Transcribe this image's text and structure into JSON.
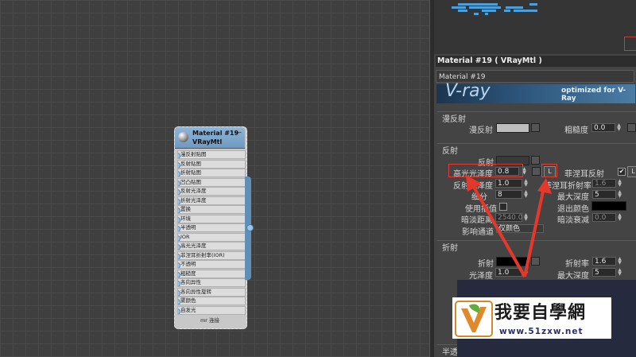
{
  "node": {
    "title_line1": "Material #19",
    "title_line2": "VRayMtl",
    "collapse": "—",
    "slots": [
      "漫反射贴图",
      "反射贴图",
      "折射贴图",
      "凹凸贴图",
      "反射光泽度",
      "折射光泽度",
      "置换",
      "环境",
      "半透明",
      "IOR",
      "高光光泽度",
      "菲涅耳折射率(IOR)",
      "不透明",
      "粗糙度",
      "各向异性",
      "各向异性旋转",
      "雾颜色",
      "自发光"
    ],
    "footer": "mr 连接"
  },
  "material": {
    "title": "Material #19 ( VRayMtl )",
    "name_field": "Material #19"
  },
  "banner": {
    "logo": "V-ray",
    "tagline": "optimized for V-Ray"
  },
  "diffuse": {
    "section": "漫反射",
    "diffuse_label": "漫反射",
    "roughness_label": "粗糙度",
    "roughness_value": "0.0",
    "diffuse_color": "#bdbdbd"
  },
  "reflection": {
    "section": "反射",
    "reflect_label": "反射",
    "hilight_gloss_label": "高光光泽度",
    "hilight_gloss_value": "0.8",
    "lock_label": "L",
    "fresnel_label": "菲涅耳反射",
    "fresnel_checked": "✔",
    "fresnel_lock": "L",
    "refl_gloss_label": "反射光泽度",
    "refl_gloss_value": "1.0",
    "fresnel_ior_label": "菲涅耳折射率",
    "fresnel_ior_value": "1.6",
    "subdivs_label": "细分",
    "subdivs_value": "8",
    "max_depth_label": "最大深度",
    "max_depth_value": "5",
    "use_interp_label": "使用插值",
    "exit_color_label": "退出颜色",
    "dim_dist_label": "暗淡距离",
    "dim_dist_value": "2540.0",
    "dim_falloff_label": "暗淡衰减",
    "dim_falloff_value": "0.0",
    "affect_channels_label": "影响通道",
    "affect_channels_value": "仅颜色",
    "reflect_color": "#3a3a3a",
    "exit_color": "#000000"
  },
  "refraction": {
    "section": "折射",
    "refract_label": "折射",
    "ior_label": "折射率",
    "ior_value": "1.6",
    "gloss_label": "光泽度",
    "gloss_value": "1.0",
    "max_depth_label": "最大深度",
    "max_depth_value": "5"
  },
  "translucency": {
    "section": "半透明"
  },
  "watermark": {
    "text": "我要自學網",
    "url": "www.51zxw.net"
  },
  "colors": {
    "accent_red": "#e23b2f",
    "node_blue": "#6f9ac1"
  }
}
